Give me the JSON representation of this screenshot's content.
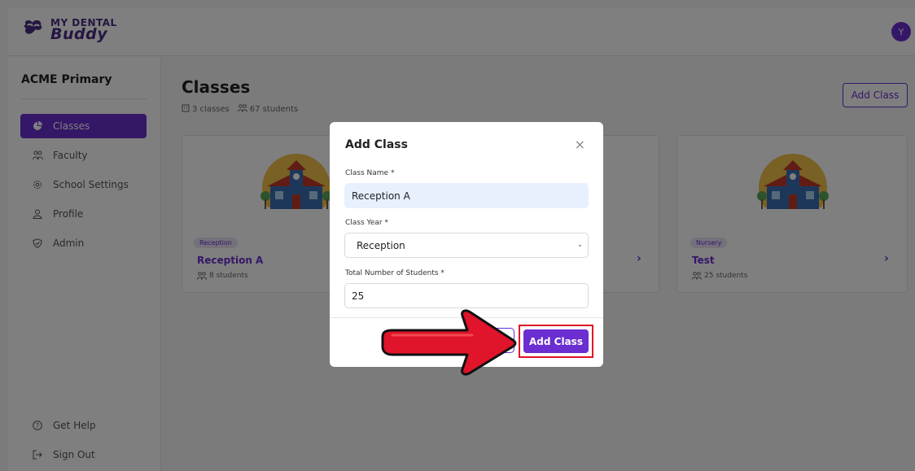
{
  "brand": {
    "line1": "MY DENTAL",
    "line2": "Buddy",
    "accent": "#6a2ed1"
  },
  "user": {
    "avatar_initial": "Y"
  },
  "sidebar": {
    "school_name": "ACME Primary",
    "items": [
      {
        "label": "Classes",
        "icon": "pie-chart-icon",
        "active": true
      },
      {
        "label": "Faculty",
        "icon": "users-icon"
      },
      {
        "label": "School Settings",
        "icon": "gear-icon"
      },
      {
        "label": "Profile",
        "icon": "user-icon"
      },
      {
        "label": "Admin",
        "icon": "shield-icon"
      }
    ],
    "footer": [
      {
        "label": "Get Help",
        "icon": "help-icon"
      },
      {
        "label": "Sign Out",
        "icon": "sign-out-icon"
      }
    ]
  },
  "main": {
    "title": "Classes",
    "classes_count": "3 classes",
    "students_count": "67 students",
    "add_class_label": "Add Class"
  },
  "cards": [
    {
      "badge": "Reception",
      "title": "Reception A",
      "count": "8 students"
    },
    {
      "badge": "",
      "title": "",
      "count": ""
    },
    {
      "badge": "Nursery",
      "title": "Test",
      "count": "25 students"
    }
  ],
  "modal": {
    "title": "Add Class",
    "close_icon": "close-icon",
    "class_name_label": "Class Name *",
    "class_name_value": "Reception A",
    "class_year_label": "Class Year *",
    "class_year_value": "Reception",
    "students_label": "Total Number of Students *",
    "students_value": "25",
    "cancel_label": "",
    "submit_label": "Add Class"
  },
  "annotation": {
    "arrow_color": "#e0142a"
  }
}
